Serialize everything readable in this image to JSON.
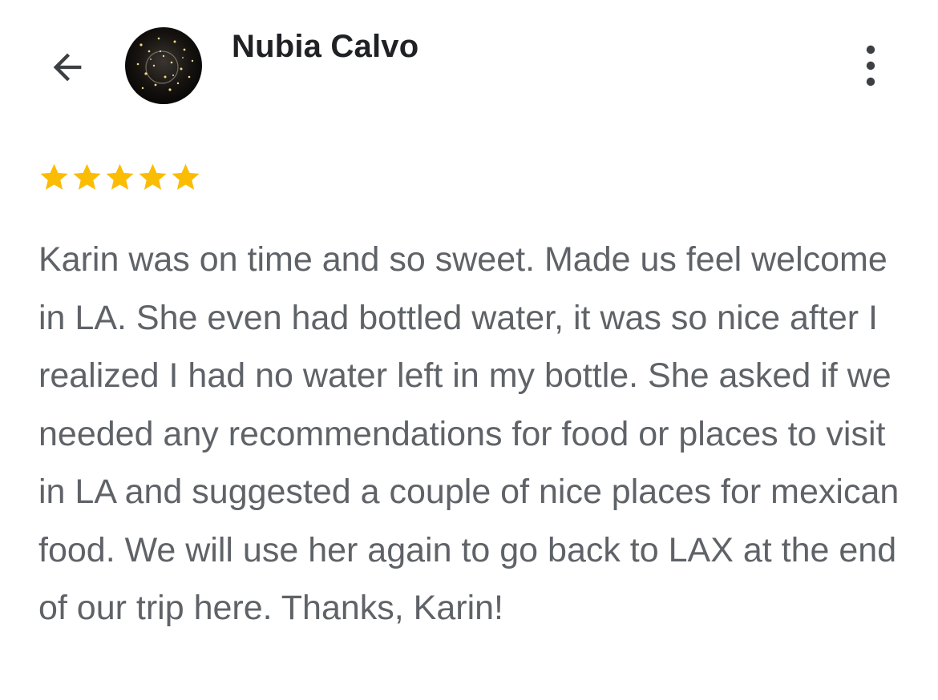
{
  "header": {
    "reviewer_name": "Nubia Calvo",
    "back_icon": "arrow-left-icon",
    "more_icon": "more-vertical-icon"
  },
  "review": {
    "rating": 5,
    "max_rating": 5,
    "star_color": "#fbbc04",
    "text": "Karin was on time and so sweet. Made us feel welcome in LA. She even had bottled water, it was so nice after I realized I had no water left in my bottle. She asked if we needed any recommendations for food or places to visit in LA and suggested a couple of nice places for mexican food. We will use her again to go back to LAX at the end of our trip here. Thanks, Karin!"
  }
}
